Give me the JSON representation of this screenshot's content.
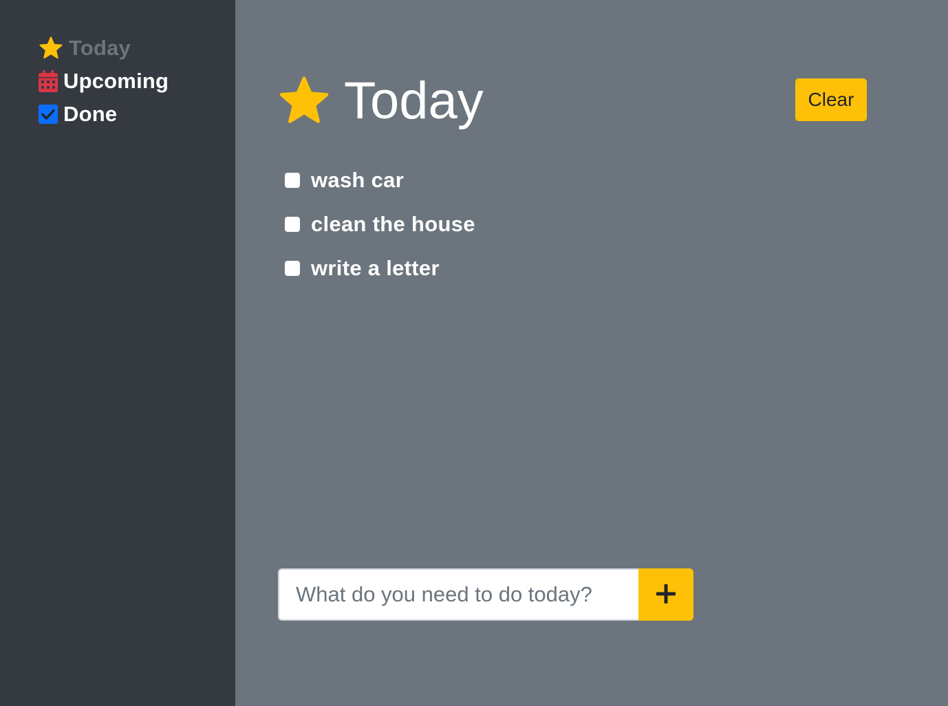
{
  "sidebar": {
    "items": [
      {
        "label": "Today",
        "icon": "star-icon",
        "color": "#6c757d",
        "icon_color": "#ffc107"
      },
      {
        "label": "Upcoming",
        "icon": "calendar-icon",
        "color": "#ffffff",
        "icon_color": "#dc3545"
      },
      {
        "label": "Done",
        "icon": "checkbox-checked-icon",
        "color": "#ffffff",
        "icon_color": "#0d6efd"
      }
    ]
  },
  "header": {
    "title": "Today",
    "icon": "star-icon",
    "clear_label": "Clear"
  },
  "tasks": [
    {
      "label": "wash car",
      "checked": false
    },
    {
      "label": "clean the house",
      "checked": false
    },
    {
      "label": "write a letter",
      "checked": false
    }
  ],
  "add_form": {
    "placeholder": "What do you need to do today?",
    "value": "",
    "button_icon": "plus-icon"
  },
  "colors": {
    "accent": "#ffc107",
    "sidebar_bg": "#343a40",
    "main_bg": "#6c757d"
  }
}
